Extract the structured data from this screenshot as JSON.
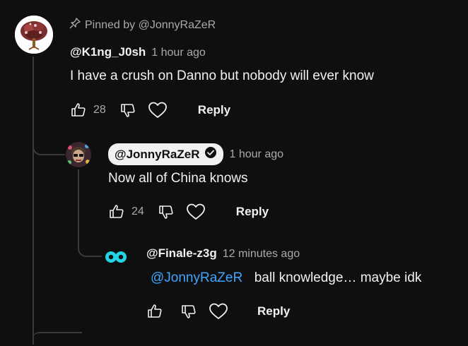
{
  "comment": {
    "pinned_label": "Pinned by @JonnyRaZeR",
    "author": "@K1ng_J0sh",
    "time": "1 hour ago",
    "text": "I have a crush on Danno but nobody will ever know",
    "likes": "28",
    "reply_label": "Reply",
    "icons": [
      "pin-icon",
      "thumb-up-icon",
      "thumb-down-icon",
      "heart-icon"
    ]
  },
  "reply1": {
    "author": "@JonnyRaZeR",
    "verified_icon": "verified-check-icon",
    "time": "1 hour ago",
    "text": "Now all of China knows",
    "likes": "24",
    "reply_label": "Reply"
  },
  "reply2": {
    "author": "@Finale-z3g",
    "time": "12 minutes ago",
    "mention": "@JonnyRaZeR",
    "text": "ball knowledge… maybe idk",
    "reply_label": "Reply"
  },
  "colors": {
    "background": "#0f0f0f",
    "text": "#f1f1f1",
    "muted": "#aaaaaa",
    "mention": "#3ea6ff",
    "owner_chip": "#f1f1f1"
  }
}
